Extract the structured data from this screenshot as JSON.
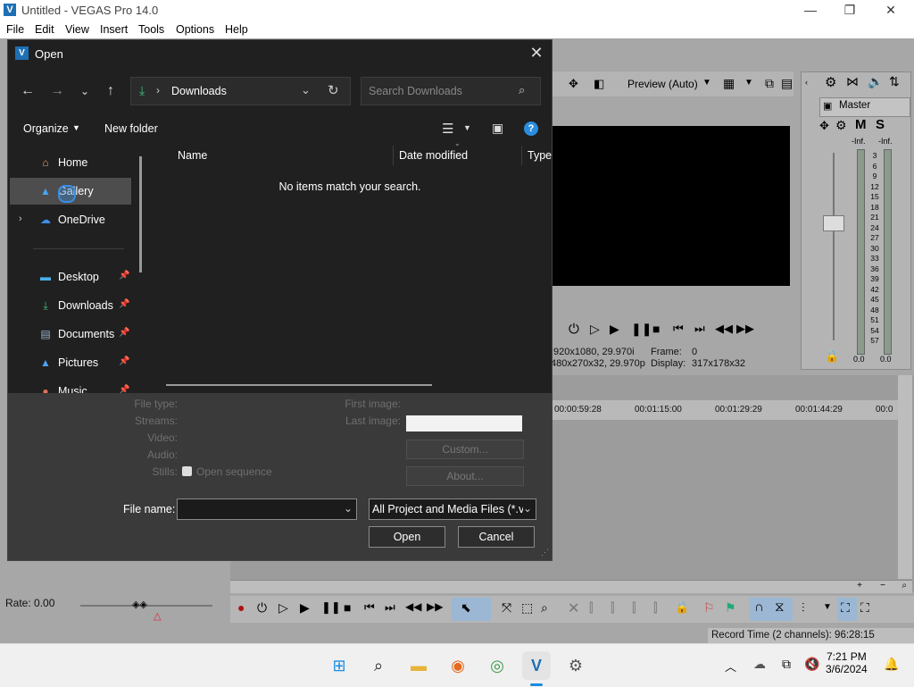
{
  "app": {
    "title": "Untitled - VEGAS Pro 14.0",
    "logo_letter": "V",
    "window_controls": [
      "—",
      "❐",
      "✕"
    ]
  },
  "menu": [
    "File",
    "Edit",
    "View",
    "Insert",
    "Tools",
    "Options",
    "Help"
  ],
  "preview": {
    "mode": "Preview (Auto)",
    "info_line1_left": ",920x1080, 29.970i",
    "info_line1_right_label": "Frame:",
    "info_line1_right_value": "0",
    "info_line2_left": "480x270x32, 29.970p",
    "info_line2_right_label": "Display:",
    "info_line2_right_value": "317x178x32"
  },
  "master": {
    "title": "Master",
    "m": "M",
    "s": "S",
    "left_inf": "-Inf.",
    "right_inf": "-Inf.",
    "scale": [
      "3",
      "6",
      "9",
      "12",
      "15",
      "18",
      "21",
      "24",
      "27",
      "30",
      "33",
      "36",
      "39",
      "42",
      "45",
      "48",
      "51",
      "54",
      "57"
    ],
    "bottom_left": "0.0",
    "bottom_right": "0.0"
  },
  "timeline": {
    "ruler": [
      "00:00:59:28",
      "00:01:15:00",
      "00:01:29:29",
      "00:01:44:29",
      "00:0"
    ]
  },
  "rate_label": "Rate: 0.00",
  "status": "Record Time (2 channels): 96:28:15",
  "dialog": {
    "title": "Open",
    "address": "Downloads",
    "search_placeholder": "Search Downloads",
    "organize": "Organize",
    "new_folder": "New folder",
    "nav_items": [
      {
        "label": "Home",
        "icon": "home-icon",
        "pinned": false
      },
      {
        "label": "Gallery",
        "icon": "gallery-icon",
        "pinned": false
      },
      {
        "label": "OneDrive",
        "icon": "cloud-icon",
        "pinned": false
      },
      {
        "label": "Desktop",
        "icon": "desktop-icon",
        "pinned": true
      },
      {
        "label": "Downloads",
        "icon": "download-icon",
        "pinned": true
      },
      {
        "label": "Documents",
        "icon": "document-icon",
        "pinned": true
      },
      {
        "label": "Pictures",
        "icon": "pictures-icon",
        "pinned": true
      },
      {
        "label": "Music",
        "icon": "music-icon",
        "pinned": true
      }
    ],
    "columns": [
      "Name",
      "Date modified",
      "Type"
    ],
    "empty_message": "No items match your search.",
    "options": {
      "file_type": "File type:",
      "streams": "Streams:",
      "video": "Video:",
      "audio": "Audio:",
      "stills": "Stills:",
      "open_sequence": "Open sequence",
      "first_image": "First image:",
      "last_image": "Last image:",
      "custom_btn": "Custom...",
      "about_btn": "About..."
    },
    "file_name_label": "File name:",
    "file_name_value": "",
    "file_type_value": "All Project and Media Files (*.ve",
    "open_btn": "Open",
    "cancel_btn": "Cancel"
  },
  "taskbar": {
    "time": "7:21 PM",
    "date": "3/6/2024"
  }
}
